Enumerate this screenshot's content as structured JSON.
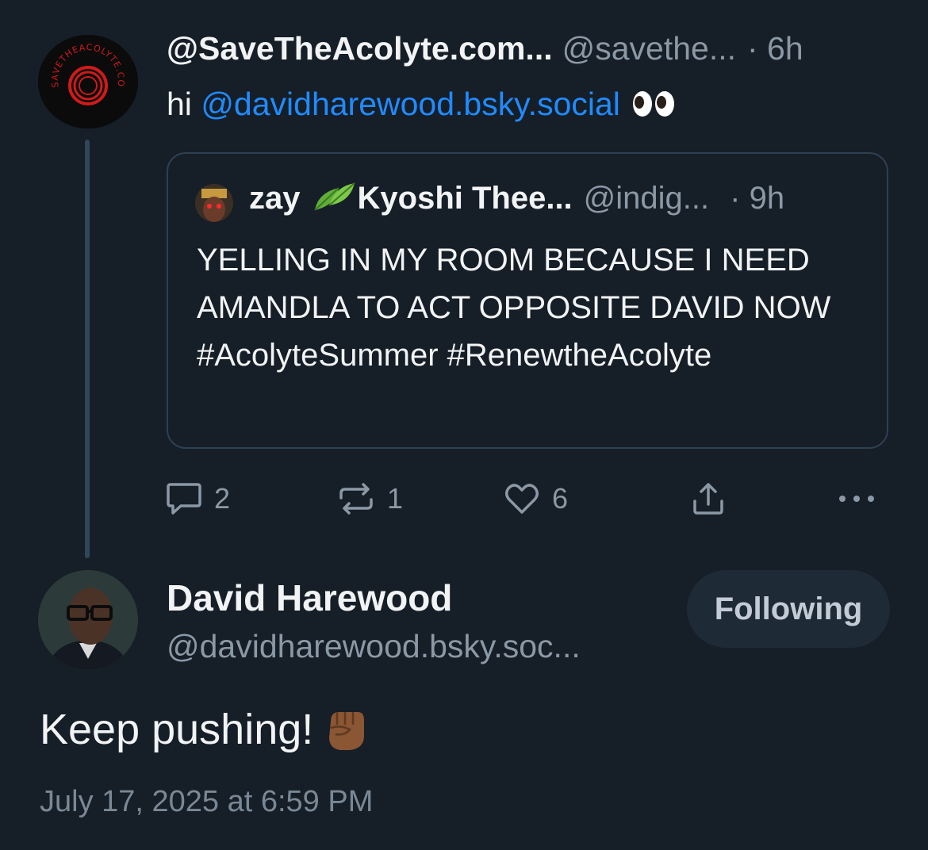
{
  "parent_post": {
    "display_name": "@SaveTheAcolyte.com...",
    "handle": "@savethe...",
    "time": "· 6h",
    "text_prefix": "hi ",
    "mention": "@davidharewood.bsky.social",
    "emoji": "eyes-emoji",
    "avatar_text": "SAVETHEACOLYTE.COM",
    "quote": {
      "display_name_1": "zay",
      "display_name_2": "Kyoshi Thee...",
      "handle": "@indig...",
      "time": "· 9h",
      "text": "YELLING IN MY ROOM BECAUSE I NEED AMANDLA TO ACT OPPOSITE DAVID NOW #AcolyteSummer #RenewtheAcolyte"
    },
    "actions": {
      "reply_count": "2",
      "repost_count": "1",
      "like_count": "6"
    }
  },
  "main_post": {
    "display_name": "David Harewood",
    "handle": "@davidharewood.bsky.soc...",
    "follow_label": "Following",
    "text": "Keep pushing!",
    "emoji": "raised-fist-emoji",
    "timestamp": "July 17, 2025 at 6:59 PM"
  },
  "colors": {
    "background": "#161e27",
    "link": "#208bfe",
    "muted": "#8b98a5",
    "thread_line": "#2f4759"
  }
}
